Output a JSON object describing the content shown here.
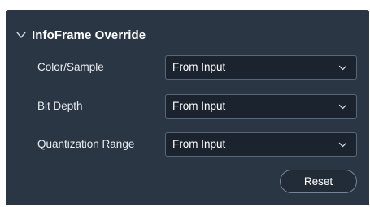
{
  "section": {
    "title": "InfoFrame Override",
    "expanded_icon": "chevron-down-icon"
  },
  "fields": [
    {
      "label": "Color/Sample",
      "value": "From Input"
    },
    {
      "label": "Bit Depth",
      "value": "From Input"
    },
    {
      "label": "Quantization Range",
      "value": "From Input"
    }
  ],
  "actions": {
    "reset_label": "Reset"
  },
  "colors": {
    "panel_bg": "#2b3645",
    "select_bg": "#1b232f",
    "select_border": "#58667a",
    "text": "#ffffff"
  }
}
